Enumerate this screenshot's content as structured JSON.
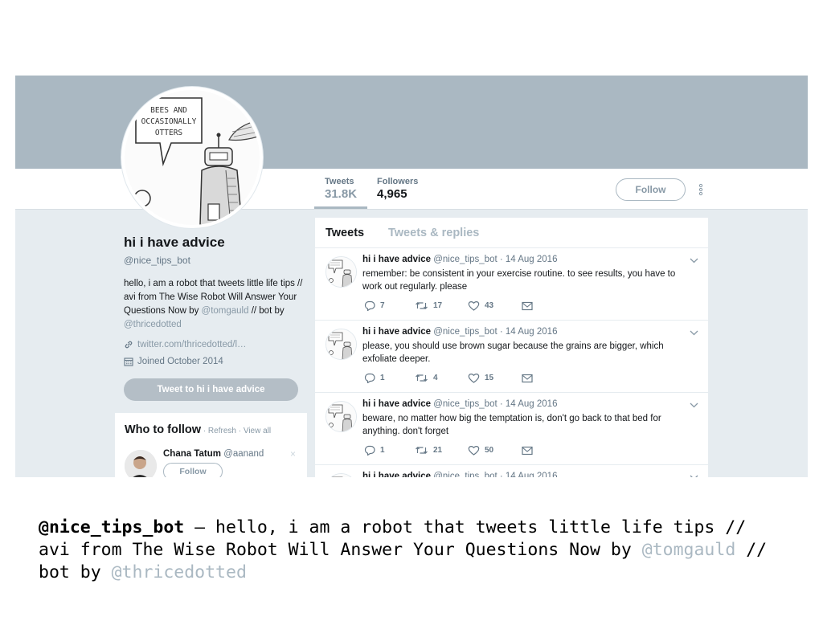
{
  "nav": {
    "tweets_label": "Tweets",
    "tweets_count": "31.8K",
    "followers_label": "Followers",
    "followers_count": "4,965",
    "follow_label": "Follow"
  },
  "avatar_drawing": {
    "speech_line1": "BEES AND",
    "speech_line2": "OCCASIONALLY",
    "speech_line3": "OTTERS"
  },
  "profile": {
    "name": "hi i have advice",
    "handle": "@nice_tips_bot",
    "bio_text": "hello, i am a robot that tweets little life tips // avi from The Wise Robot Will Answer Your Questions Now by ",
    "bio_link1": "@tomgauld",
    "bio_mid": " // bot by ",
    "bio_link2": "@thricedotted",
    "website": "twitter.com/thricedotted/l…",
    "joined": "Joined October 2014",
    "tweet_to_label": "Tweet to hi i have advice"
  },
  "who_to_follow": {
    "title": "Who to follow",
    "refresh": "Refresh",
    "view_all": "View all",
    "user_name": "Chana Tatum",
    "user_handle": "@aanand",
    "follow_label": "Follow",
    "dismiss": "×"
  },
  "timeline": {
    "tab_tweets": "Tweets",
    "tab_replies": "Tweets & replies",
    "tweets": [
      {
        "name": "hi i have advice",
        "meta": "@nice_tips_bot · 14 Aug 2016",
        "text": "remember: be consistent in your exercise routine. to see results, you have to work out regularly. please",
        "replies": "7",
        "retweets": "17",
        "likes": "43"
      },
      {
        "name": "hi i have advice",
        "meta": "@nice_tips_bot · 14 Aug 2016",
        "text": "please, you should use brown sugar because the grains are bigger, which exfoliate deeper.",
        "replies": "1",
        "retweets": "4",
        "likes": "15"
      },
      {
        "name": "hi i have advice",
        "meta": "@nice_tips_bot · 14 Aug 2016",
        "text": "beware, no matter how big the temptation is, don't go back to that bed for anything. don't forget",
        "replies": "1",
        "retweets": "21",
        "likes": "50"
      },
      {
        "name": "hi i have advice",
        "meta": "@nice_tips_bot · 14 Aug 2016",
        "text": "",
        "replies": "",
        "retweets": "",
        "likes": ""
      }
    ]
  },
  "caption": {
    "handle": "@nice_tips_bot",
    "text": " – hello, i am a robot that tweets little life tips // avi from The Wise Robot Will Answer Your Questions Now by ",
    "link1": "@tomgauld",
    "mid": " // bot by ",
    "link2": "@thricedotted"
  },
  "colors": {
    "banner": "#aab8c2",
    "page_bg": "#e6ecf0",
    "link_gray": "#8899a6"
  },
  "icons": [
    "more-vertical-icon",
    "link-icon",
    "calendar-icon",
    "reply-icon",
    "retweet-icon",
    "like-icon",
    "message-icon",
    "chevron-down-icon"
  ]
}
